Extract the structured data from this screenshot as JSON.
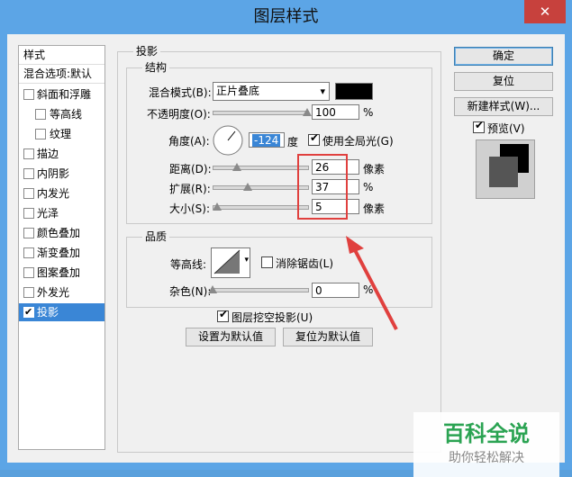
{
  "window": {
    "title": "图层样式",
    "close_glyph": "✕"
  },
  "styles_list": {
    "header": "样式",
    "blend_options": "混合选项:默认",
    "items": [
      {
        "label": "斜面和浮雕",
        "checked": false,
        "indent": false
      },
      {
        "label": "等高线",
        "checked": false,
        "indent": true
      },
      {
        "label": "纹理",
        "checked": false,
        "indent": true
      },
      {
        "label": "描边",
        "checked": false,
        "indent": false
      },
      {
        "label": "内阴影",
        "checked": false,
        "indent": false
      },
      {
        "label": "内发光",
        "checked": false,
        "indent": false
      },
      {
        "label": "光泽",
        "checked": false,
        "indent": false
      },
      {
        "label": "颜色叠加",
        "checked": false,
        "indent": false
      },
      {
        "label": "渐变叠加",
        "checked": false,
        "indent": false
      },
      {
        "label": "图案叠加",
        "checked": false,
        "indent": false
      },
      {
        "label": "外发光",
        "checked": false,
        "indent": false
      },
      {
        "label": "投影",
        "checked": true,
        "indent": false,
        "selected": true
      }
    ]
  },
  "panel": {
    "title": "投影",
    "structure": {
      "title": "结构",
      "blend_mode_label": "混合模式(B):",
      "blend_mode_value": "正片叠底",
      "blend_color": "#000000",
      "opacity_label": "不透明度(O):",
      "opacity_value": "100",
      "opacity_unit": "%",
      "opacity_pct": 100,
      "angle_label": "角度(A):",
      "angle_value": "-124",
      "angle_unit": "度",
      "global_light_label": "使用全局光(G)",
      "global_light_checked": true,
      "distance_label": "距离(D):",
      "distance_value": "26",
      "distance_unit": "像素",
      "distance_pct": 26,
      "spread_label": "扩展(R):",
      "spread_value": "37",
      "spread_unit": "%",
      "spread_pct": 37,
      "size_label": "大小(S):",
      "size_value": "5",
      "size_unit": "像素",
      "size_pct": 5
    },
    "quality": {
      "title": "品质",
      "contour_label": "等高线:",
      "antialias_label": "消除锯齿(L)",
      "antialias_checked": false,
      "noise_label": "杂色(N):",
      "noise_value": "0",
      "noise_unit": "%",
      "noise_pct": 0
    },
    "knockout_label": "图层挖空投影(U)",
    "knockout_checked": true,
    "make_default": "设置为默认值",
    "reset_default": "复位为默认值"
  },
  "buttons": {
    "ok": "确定",
    "reset": "复位",
    "new_style": "新建样式(W)...",
    "preview_label": "预览(V)",
    "preview_checked": true
  },
  "watermark": {
    "title": "百科全说",
    "subtitle": "助你轻松解决"
  }
}
